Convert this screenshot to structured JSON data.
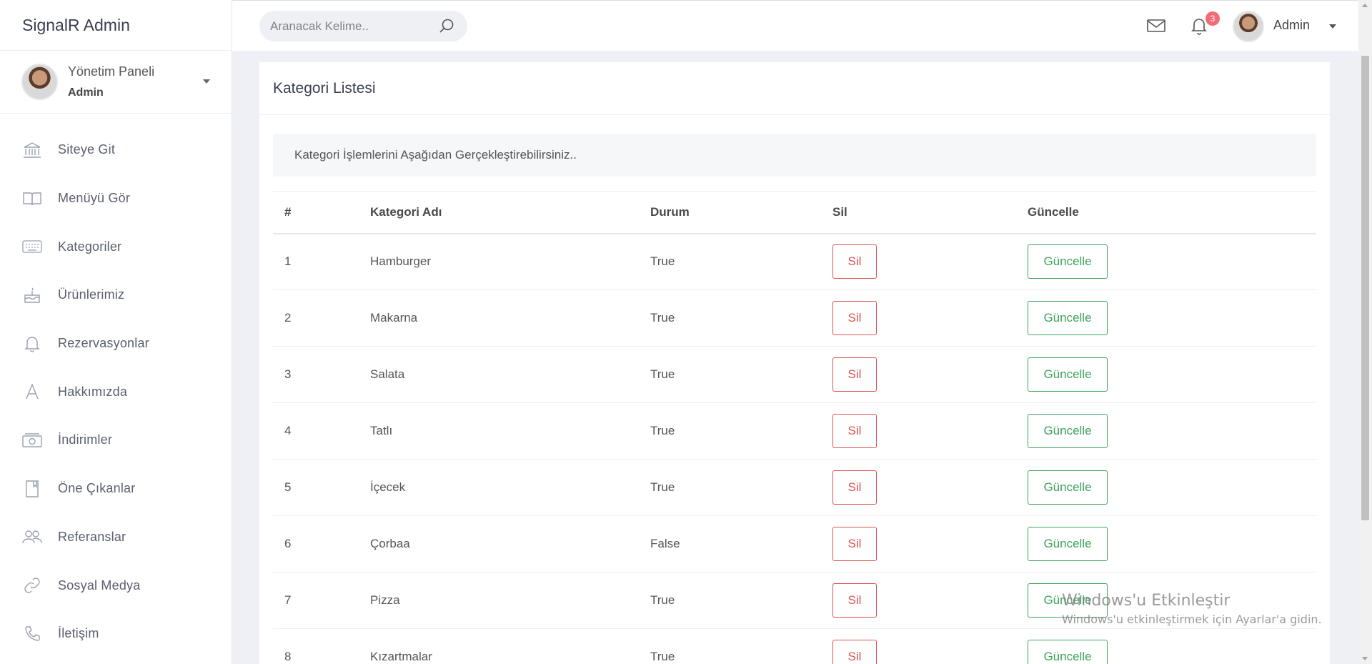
{
  "brand": "SignalR Admin",
  "profile": {
    "title": "Yönetim Paneli",
    "role": "Admin"
  },
  "sidebar": {
    "items": [
      {
        "label": "Siteye Git",
        "icon": "bank-icon"
      },
      {
        "label": "Menüyü Gör",
        "icon": "book-icon"
      },
      {
        "label": "Kategoriler",
        "icon": "keyboard-icon"
      },
      {
        "label": "Ürünlerimiz",
        "icon": "cake-icon"
      },
      {
        "label": "Rezervasyonlar",
        "icon": "bell-icon"
      },
      {
        "label": "Hakkımızda",
        "icon": "letter-a-icon"
      },
      {
        "label": "İndirimler",
        "icon": "money-icon"
      },
      {
        "label": "Öne Çıkanlar",
        "icon": "bookmark-icon"
      },
      {
        "label": "Referanslar",
        "icon": "users-icon"
      },
      {
        "label": "Sosyal Medya",
        "icon": "link-icon"
      },
      {
        "label": "İletişim",
        "icon": "phone-icon"
      }
    ]
  },
  "topbar": {
    "search_placeholder": "Aranacak Kelime..",
    "notification_count": "3",
    "user_name": "Admin"
  },
  "card": {
    "title": "Kategori Listesi",
    "info": "Kategori İşlemlerini Aşağıdan Gerçekleştirebilirsiniz.."
  },
  "table": {
    "headers": [
      "#",
      "Kategori Adı",
      "Durum",
      "Sil",
      "Güncelle"
    ],
    "rows": [
      {
        "id": "1",
        "name": "Hamburger",
        "status": "True"
      },
      {
        "id": "2",
        "name": "Makarna",
        "status": "True"
      },
      {
        "id": "3",
        "name": "Salata",
        "status": "True"
      },
      {
        "id": "4",
        "name": "Tatlı",
        "status": "True"
      },
      {
        "id": "5",
        "name": "İçecek",
        "status": "True"
      },
      {
        "id": "6",
        "name": "Çorbaa",
        "status": "False"
      },
      {
        "id": "7",
        "name": "Pizza",
        "status": "True"
      },
      {
        "id": "8",
        "name": "Kızartmalar",
        "status": "True"
      }
    ],
    "delete_label": "Sil",
    "update_label": "Güncelle"
  },
  "watermark": {
    "title": "Windows'u Etkinleştir",
    "subtitle": "Windows'u etkinleştirmek için Ayarlar'a gidin."
  },
  "colors": {
    "danger": "#d9534f",
    "success": "#3fa35b",
    "badge": "#f16d75"
  }
}
